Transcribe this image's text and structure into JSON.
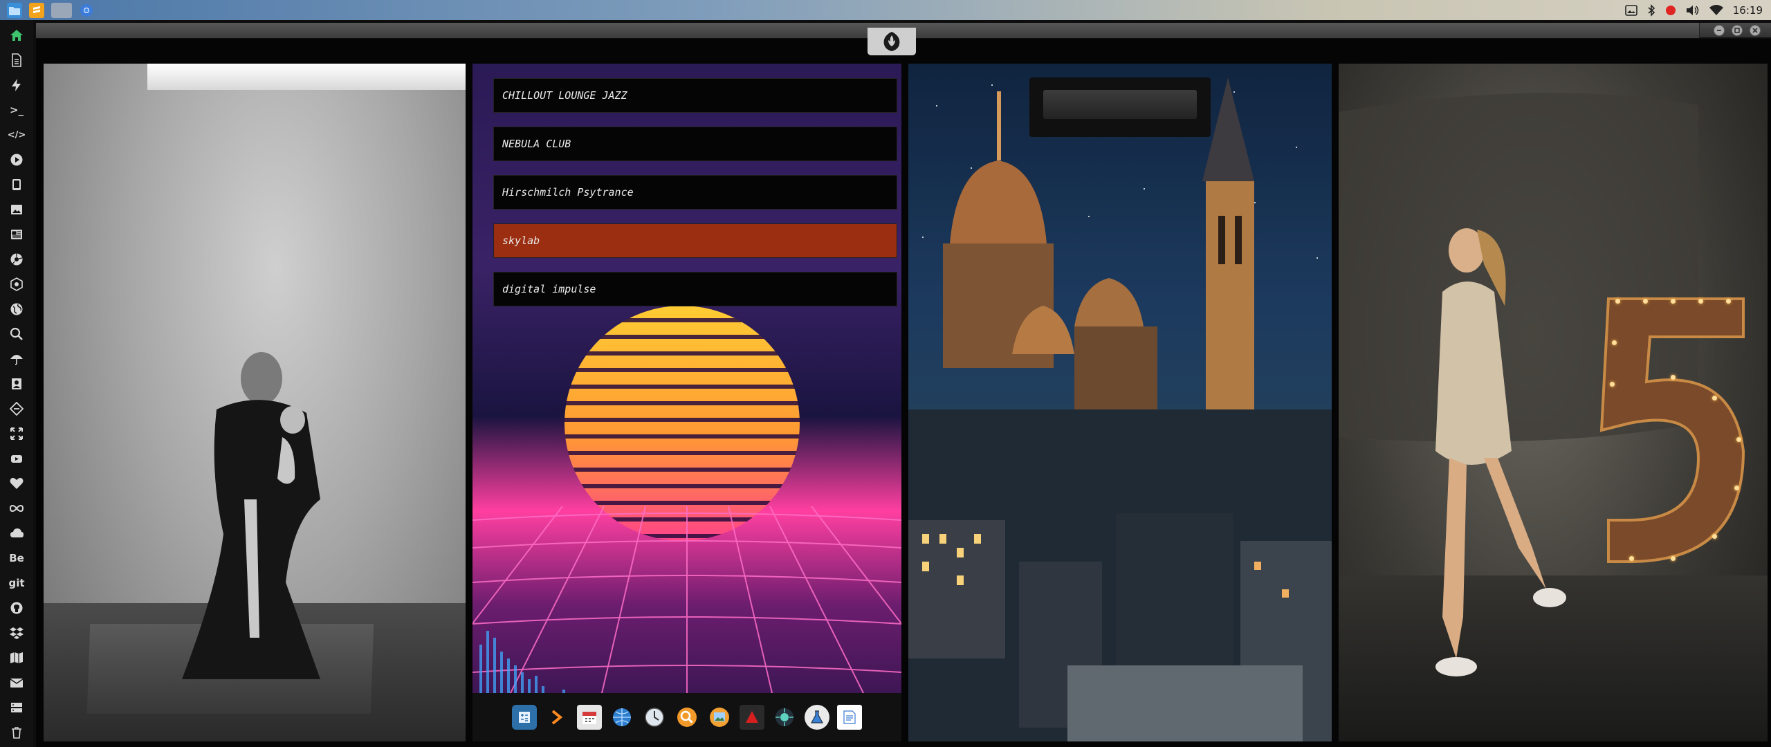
{
  "system_panel": {
    "clock": "16:19",
    "tray_icons": [
      "image-icon",
      "bluetooth-icon",
      "record-icon",
      "volume-icon",
      "wifi-icon"
    ]
  },
  "left_dock": {
    "items": [
      {
        "name": "home-icon"
      },
      {
        "name": "document-icon"
      },
      {
        "name": "bolt-icon"
      },
      {
        "name": "terminal-icon",
        "label": ">_"
      },
      {
        "name": "code-icon",
        "label": "</>"
      },
      {
        "name": "play-icon"
      },
      {
        "name": "tablet-icon"
      },
      {
        "name": "image-icon"
      },
      {
        "name": "newspaper-icon"
      },
      {
        "name": "aperture-icon"
      },
      {
        "name": "hexagon-icon"
      },
      {
        "name": "globe-icon"
      },
      {
        "name": "search-icon"
      },
      {
        "name": "umbrella-icon"
      },
      {
        "name": "id-card-icon"
      },
      {
        "name": "tag-icon"
      },
      {
        "name": "expand-icon"
      },
      {
        "name": "youtube-icon"
      },
      {
        "name": "heart-icon"
      },
      {
        "name": "infinity-icon"
      },
      {
        "name": "cloud-icon"
      },
      {
        "name": "behance-icon",
        "label": "Be"
      },
      {
        "name": "git-icon",
        "label": "git"
      },
      {
        "name": "github-icon"
      },
      {
        "name": "dropbox-icon"
      },
      {
        "name": "map-icon"
      },
      {
        "name": "mail-icon"
      },
      {
        "name": "server-icon"
      },
      {
        "name": "trash-icon"
      }
    ]
  },
  "radio": {
    "stations": [
      {
        "label": "CHILLOUT LOUNGE JAZZ",
        "active": false
      },
      {
        "label": "NEBULA CLUB",
        "active": false
      },
      {
        "label": "Hirschmilch Psytrance",
        "active": false
      },
      {
        "label": "skylab",
        "active": true
      },
      {
        "label": "digital impulse",
        "active": false
      }
    ],
    "dock_icons": [
      "calculator-icon",
      "chevron-app-icon",
      "calendar-icon",
      "globe-app-icon",
      "clock-icon",
      "magnifier-app-icon",
      "photo-app-icon",
      "pdf-app-icon",
      "chip-app-icon",
      "flask-app-icon",
      "note-app-icon"
    ]
  },
  "colors": {
    "active_station": "#9b2d10",
    "station_bg": "#050505",
    "dock_bg": "#121212"
  }
}
